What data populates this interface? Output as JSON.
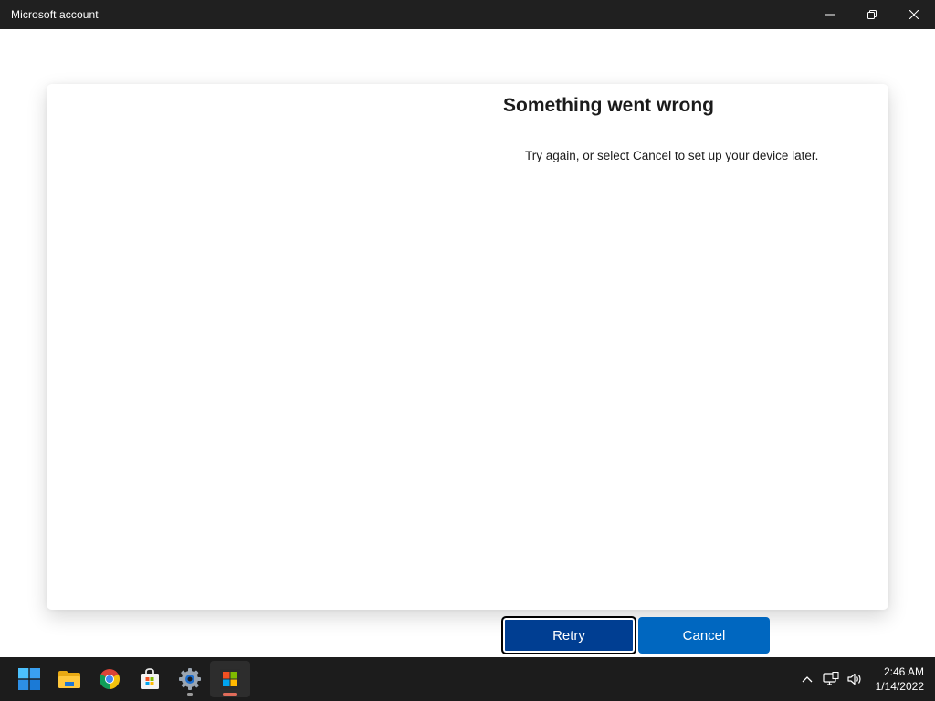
{
  "window": {
    "title": "Microsoft account"
  },
  "dialog": {
    "heading": "Something went wrong",
    "message": "Try again, or select Cancel to set up your device later.",
    "retry_label": "Retry",
    "cancel_label": "Cancel"
  },
  "colors": {
    "titlebar_bg": "#202020",
    "retry_bg": "#003e92",
    "cancel_bg": "#0067c0",
    "taskbar_bg": "#1c1c1c"
  },
  "taskbar": {
    "apps": [
      {
        "name": "start-icon"
      },
      {
        "name": "file-explorer-icon"
      },
      {
        "name": "chrome-icon"
      },
      {
        "name": "store-icon"
      },
      {
        "name": "settings-icon"
      },
      {
        "name": "microsoft-account-icon"
      }
    ],
    "time": "2:46 AM",
    "date": "1/14/2022"
  }
}
